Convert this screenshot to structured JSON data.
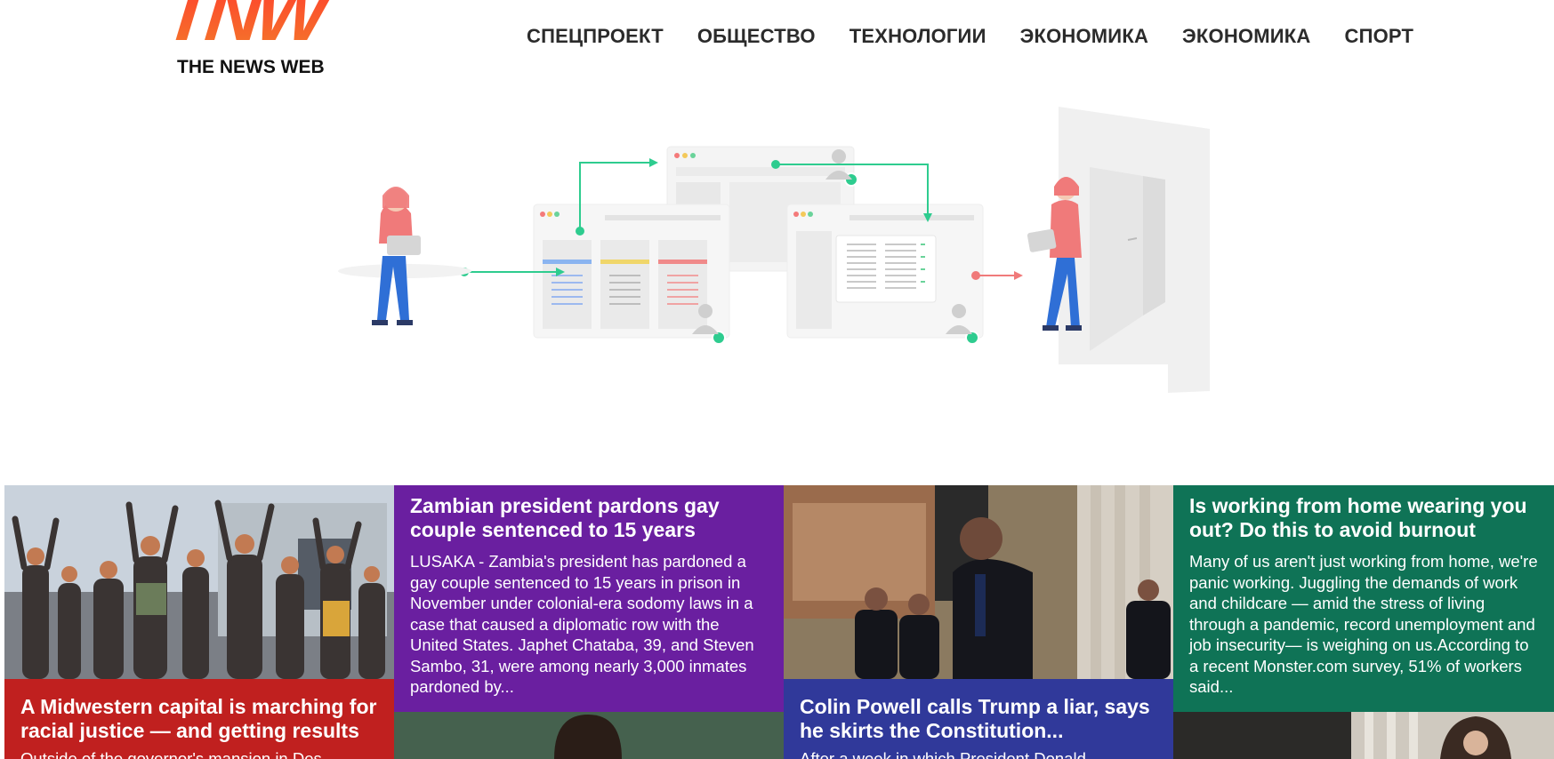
{
  "site": {
    "logo_mark": "TNW",
    "logo_sub": "THE NEWS WEB",
    "brand_color": "#f05a22"
  },
  "nav": {
    "items": [
      {
        "label": "СПЕЦПРОЕКТ"
      },
      {
        "label": "ОБЩЕСТВО"
      },
      {
        "label": "ТЕХНОЛОГИИ"
      },
      {
        "label": "ЭКОНОМИКА"
      },
      {
        "label": "ЭКОНОМИКА"
      },
      {
        "label": "СПОРТ"
      }
    ]
  },
  "hero": {
    "illustration": "workflow-illustration",
    "accent_green": "#2ecc8f",
    "accent_red": "#f05a5a"
  },
  "news": {
    "cards": [
      {
        "title": "A Midwestern capital is marching for racial justice — and getting results",
        "excerpt": "Outside of the governor's mansion in Des",
        "color": "#c0201f",
        "image": "protest-crowd-photo"
      },
      {
        "title": "Zambian president pardons gay couple sentenced to 15 years",
        "excerpt": "LUSAKA - Zambia's president has pardoned a gay couple sentenced to 15 years in prison in November under colonial-era sodomy laws in a case that caused a diplomatic row with the United States. Japhet Chataba, 39, and Steven Sambo, 31, were among nearly 3,000 inmates pardoned by...",
        "color": "#6a1fa0",
        "image": "president-portrait-photo"
      },
      {
        "title": "Colin Powell calls Trump a liar, says he skirts the Constitution...",
        "excerpt": "After a week in which President Donald",
        "color": "#30399a",
        "image": "capitol-rotunda-photo"
      },
      {
        "title": "Is working from home wearing you out? Do this to avoid burnout",
        "excerpt": "Many of us aren't just working from home, we're panic working. Juggling the demands of work and childcare — amid the stress of living through a pandemic, record unemployment and job insecurity— is weighing on us.According to a recent Monster.com survey, 51% of workers said...",
        "color": "#0f7356",
        "image": "home-office-photo"
      }
    ]
  }
}
